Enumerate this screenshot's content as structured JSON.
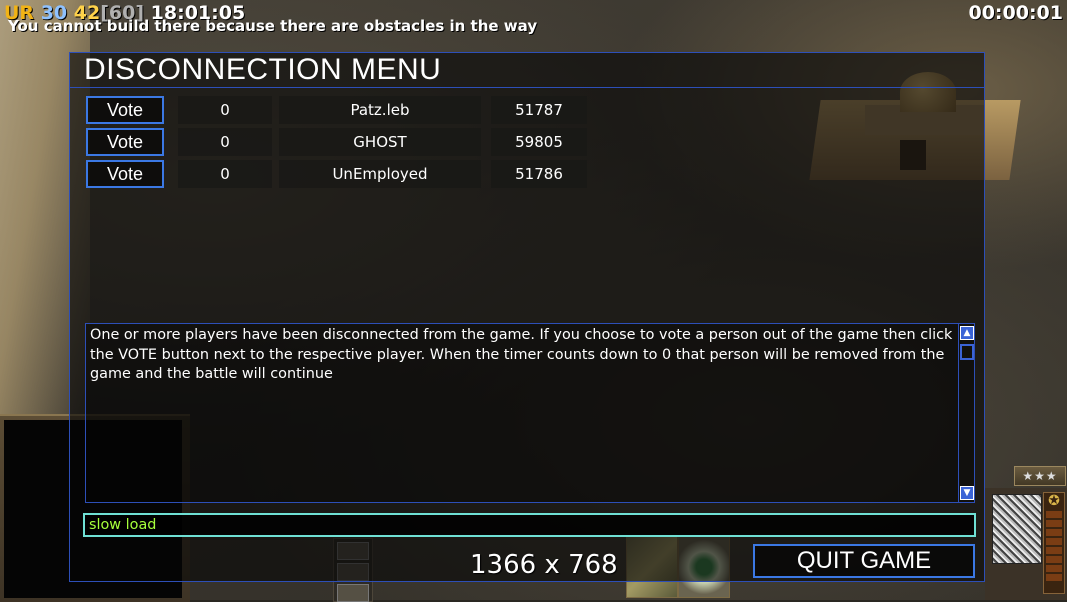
{
  "hud": {
    "faction": "UR",
    "stat1": "30",
    "stat2": "42",
    "fps_bracket": "[60]",
    "clock": "18:01:05",
    "timer": "00:00:01",
    "notice": "You cannot build there because there are obstacles in the way"
  },
  "dialog": {
    "title": "DISCONNECTION MENU",
    "players": [
      {
        "vote_label": "Vote",
        "votes": "0",
        "name": "Patz.leb",
        "id": "51787"
      },
      {
        "vote_label": "Vote",
        "votes": "0",
        "name": "GHOST",
        "id": "59805"
      },
      {
        "vote_label": "Vote",
        "votes": "0",
        "name": "UnEmployed",
        "id": "51786"
      }
    ],
    "message": "One or more players have been disconnected from the game. If you choose to vote a person out of the game then click the VOTE button next to the respective player. When the timer counts down to 0 that person will be removed from the game and the battle will continue",
    "chat_value": "slow load",
    "quit_label": "QUIT GAME"
  },
  "overlay": {
    "resolution": "1366 x 768"
  },
  "icons": {
    "scroll_up": "triangle-up-icon",
    "scroll_down": "triangle-down-icon",
    "rank": "star-icon"
  },
  "colors": {
    "dialog_border": "#2d4fb8",
    "button_border": "#3b78e4",
    "chat_border": "#6fe0d4",
    "chat_text": "#a6ff3b",
    "faction": "#f2b315"
  }
}
